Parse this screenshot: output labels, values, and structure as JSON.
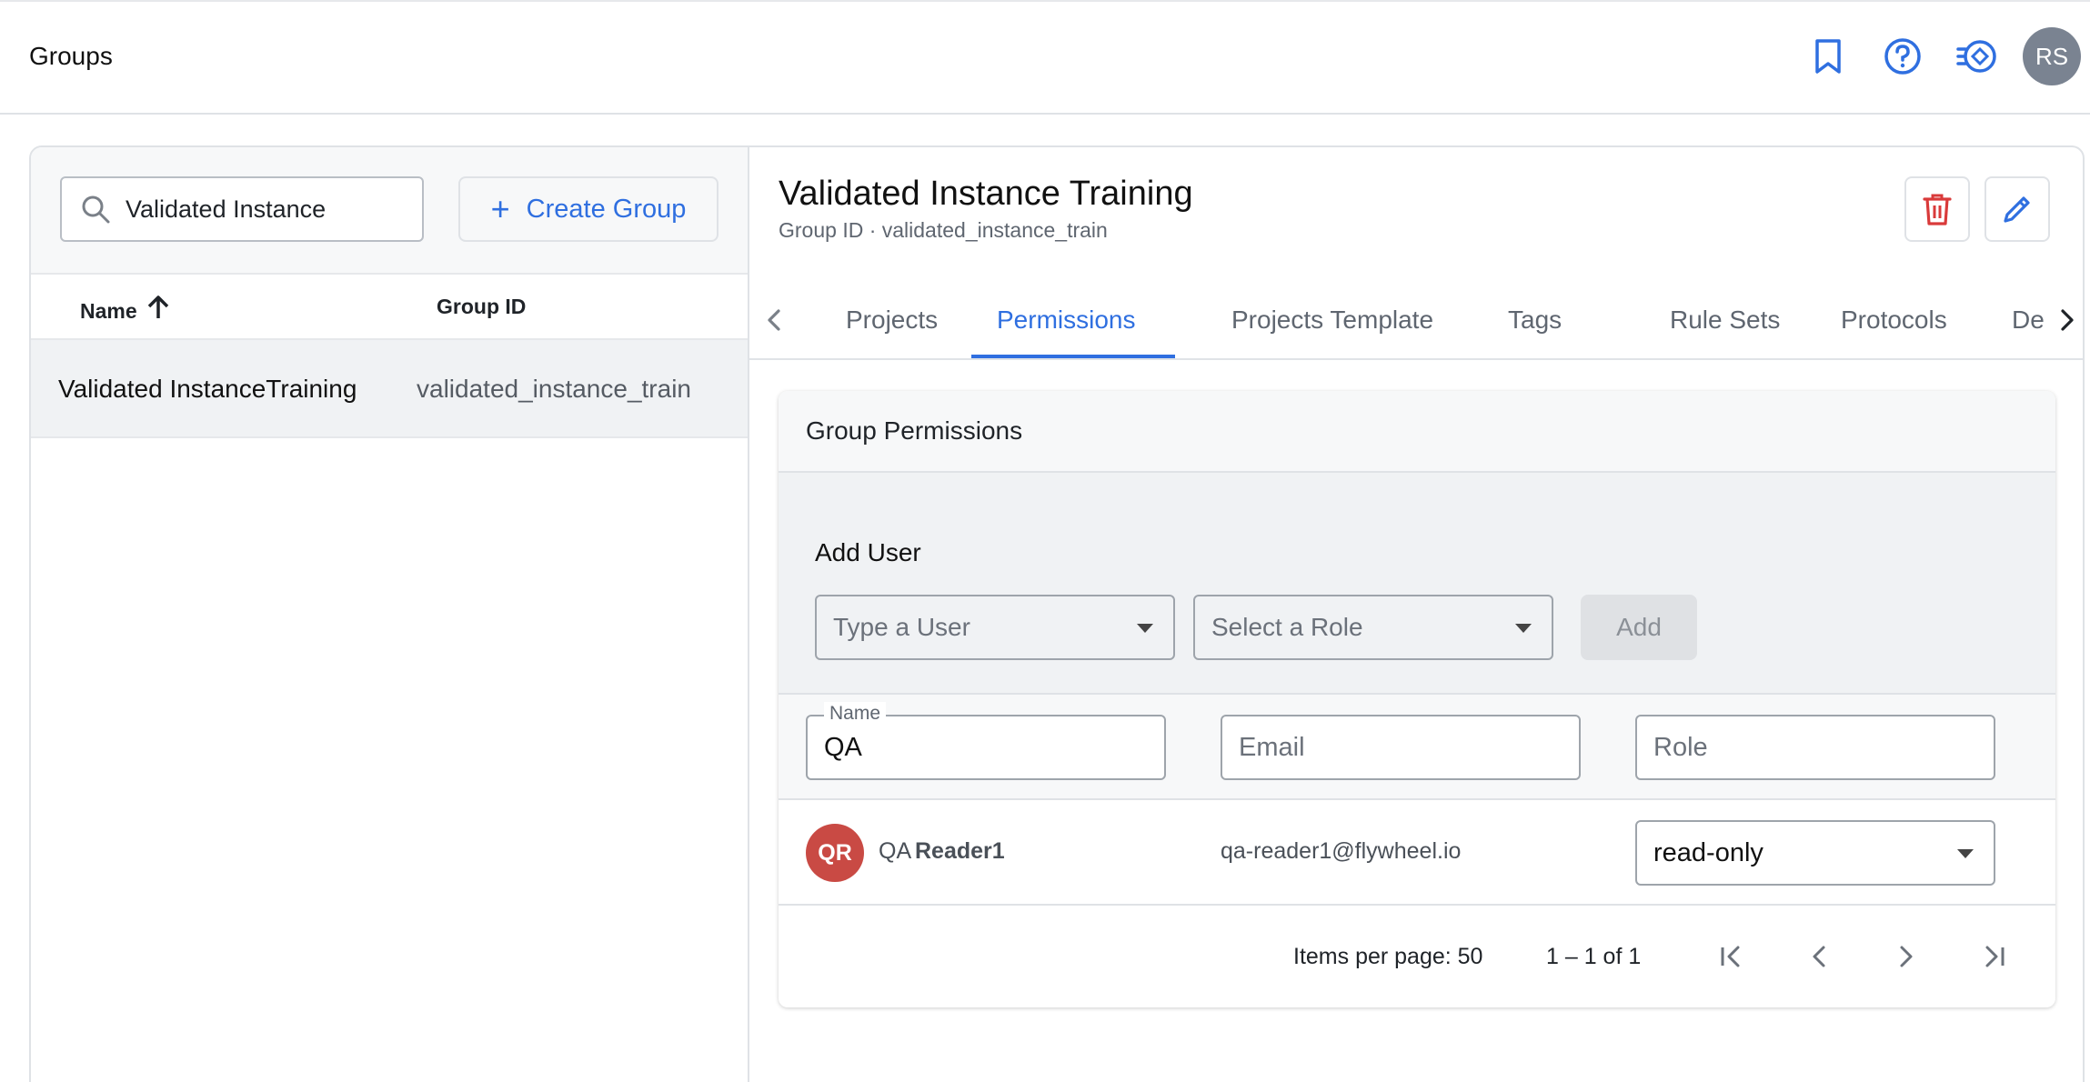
{
  "header": {
    "title": "Groups",
    "avatar_initials": "RS"
  },
  "icons": {
    "bookmark": "bookmark-icon",
    "help": "help-circle-icon",
    "updates": "updates-icon"
  },
  "colors": {
    "accent": "#2f6fe0",
    "danger": "#d93a3a",
    "avatar_qr": "#c94a44"
  },
  "left": {
    "search": {
      "value": "Validated Instance"
    },
    "create_label": "Create Group",
    "columns": {
      "name": "Name",
      "group_id": "Group ID"
    },
    "rows": [
      {
        "name": "Validated InstanceTraining",
        "group_id": "validated_instance_train"
      }
    ]
  },
  "detail": {
    "title": "Validated Instance Training",
    "subtitle": "Group ID · validated_instance_train",
    "tabs": [
      {
        "label": "Projects",
        "active": false
      },
      {
        "label": "Permissions",
        "active": true
      },
      {
        "label": "Projects Template",
        "active": false
      },
      {
        "label": "Tags",
        "active": false
      },
      {
        "label": "Rule Sets",
        "active": false
      },
      {
        "label": "Protocols",
        "active": false
      },
      {
        "label": "De-ID Settings",
        "active": false
      }
    ]
  },
  "permissions": {
    "title": "Group Permissions",
    "add_user": {
      "label": "Add User",
      "user_placeholder": "Type a User",
      "role_placeholder": "Select a Role",
      "add_label": "Add"
    },
    "filters": {
      "name_legend": "Name",
      "name_value": "QA",
      "email_placeholder": "Email",
      "role_placeholder": "Role"
    },
    "users": [
      {
        "initials": "QR",
        "first": "QA",
        "last": "Reader1",
        "email": "qa-reader1@flywheel.io",
        "role": "read-only"
      }
    ],
    "pagination": {
      "items_per_page": "Items per page: 50",
      "range": "1 – 1 of 1"
    }
  }
}
